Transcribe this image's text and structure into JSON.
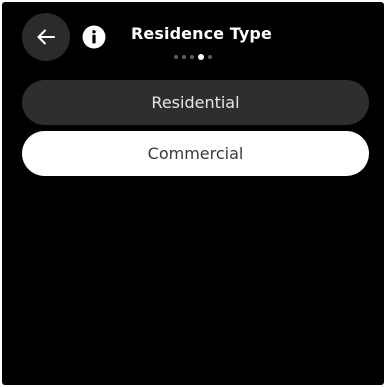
{
  "header": {
    "back_icon": "arrow-left-icon",
    "info_icon": "info-icon",
    "title": "Residence Type"
  },
  "pager": {
    "total_pages": 5,
    "current_page": 4
  },
  "options": [
    {
      "label": "Residential",
      "selected": false
    },
    {
      "label": "Commercial",
      "selected": true
    }
  ],
  "colors": {
    "background": "#000000",
    "surface_dark": "#2e2e2e",
    "surface_light": "#ffffff"
  }
}
